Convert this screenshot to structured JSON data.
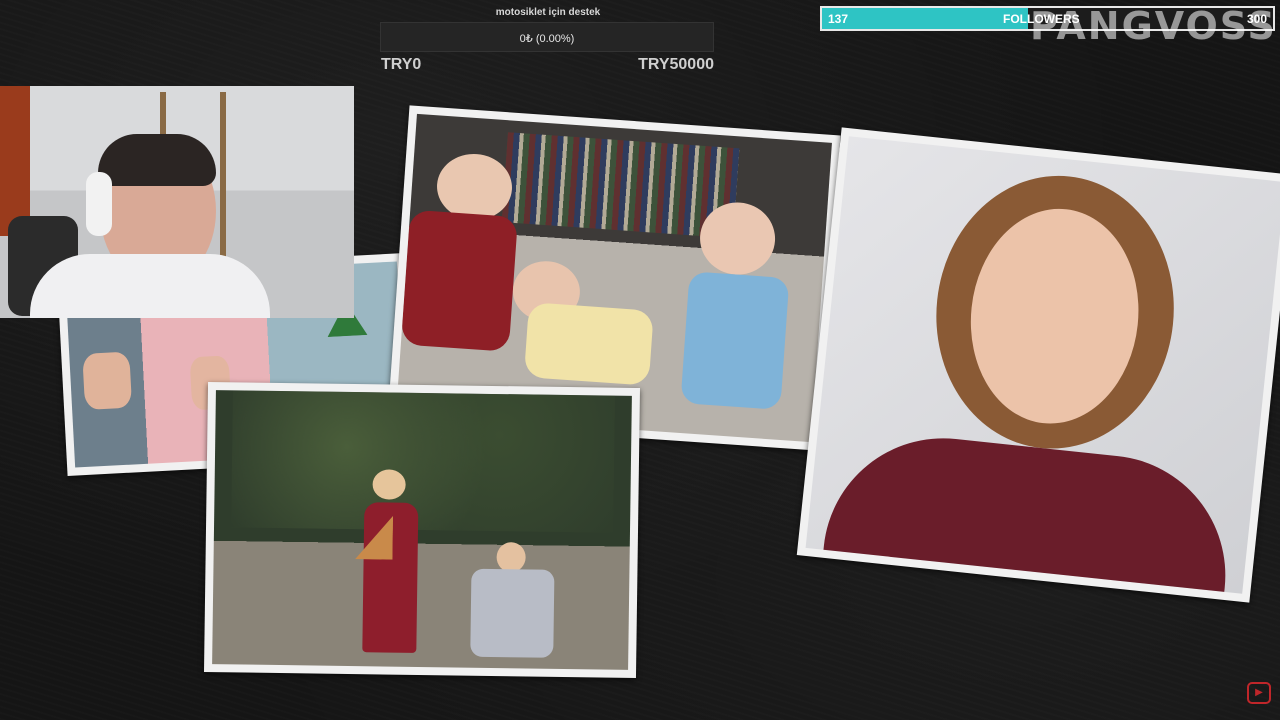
{
  "donation_goal": {
    "title": "motosiklet için destek",
    "progress_text": "0₺ (0.00%)",
    "progress_fraction": 0.0,
    "min_label": "TRY0",
    "max_label": "TRY50000"
  },
  "followers": {
    "current": "137",
    "label": "FOLLOWERS",
    "goal": "300",
    "progress_fraction": 0.457,
    "bar_color": "#2ec4c4"
  },
  "watermark": "PANGVOSS",
  "icons": {
    "bottom_right": "youtube-logo-icon"
  }
}
